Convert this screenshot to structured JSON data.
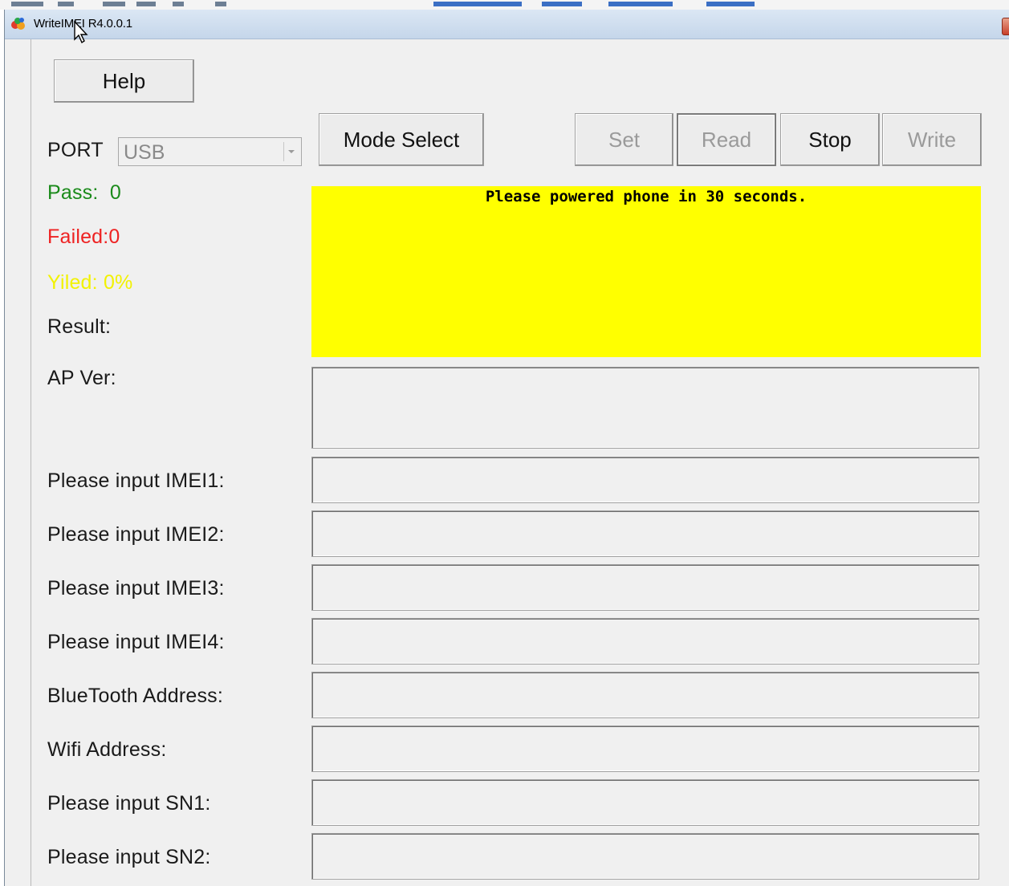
{
  "window": {
    "title": "WriteIMEI R4.0.0.1"
  },
  "toolbar": {
    "help_label": "Help",
    "mode_select_label": "Mode Select",
    "set_label": "Set",
    "read_label": "Read",
    "stop_label": "Stop",
    "write_label": "Write"
  },
  "port": {
    "label": "PORT",
    "value": "USB"
  },
  "stats": {
    "pass_label": "Pass:  0",
    "failed_label": "Failed:0",
    "yield_label": "Yiled: 0%",
    "result_label": "Result:",
    "pass_color": "#1a8a1a",
    "failed_color": "#ee2222",
    "yield_color": "#f2f200"
  },
  "status": {
    "message": "Please powered phone in 30 seconds.",
    "background": "#ffff00"
  },
  "ap_version": {
    "label": "AP Ver:",
    "value": ""
  },
  "fields": {
    "imei1": {
      "label": "Please input IMEI1:",
      "value": ""
    },
    "imei2": {
      "label": "Please input IMEI2:",
      "value": ""
    },
    "imei3": {
      "label": "Please input IMEI3:",
      "value": ""
    },
    "imei4": {
      "label": "Please input IMEI4:",
      "value": ""
    },
    "bluetooth": {
      "label": "BlueTooth Address:",
      "value": ""
    },
    "wifi": {
      "label": "Wifi Address:",
      "value": ""
    },
    "sn1": {
      "label": "Please input SN1:",
      "value": ""
    },
    "sn2": {
      "label": "Please input SN2:",
      "value": ""
    }
  }
}
